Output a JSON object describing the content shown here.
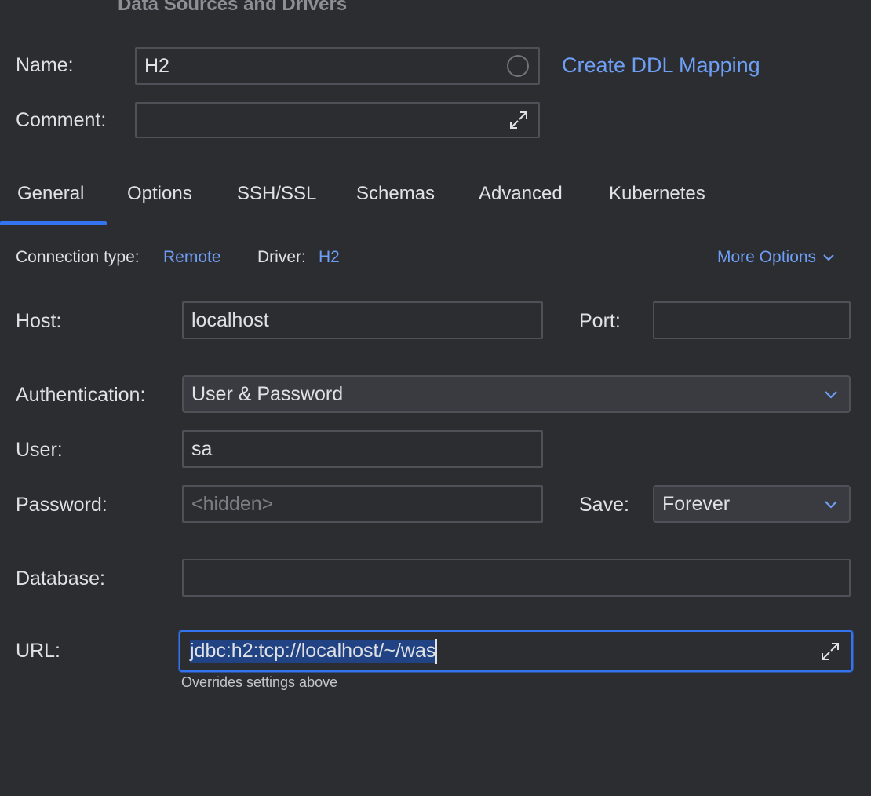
{
  "dialog": {
    "title": "Data Sources and Drivers"
  },
  "name_field": {
    "label": "Name:",
    "value": "H2"
  },
  "ddl_link": "Create DDL Mapping",
  "comment_field": {
    "label": "Comment:",
    "value": ""
  },
  "tabs": [
    {
      "label": "General",
      "active": true
    },
    {
      "label": "Options"
    },
    {
      "label": "SSH/SSL"
    },
    {
      "label": "Schemas"
    },
    {
      "label": "Advanced"
    },
    {
      "label": "Kubernetes"
    }
  ],
  "connection": {
    "type_label": "Connection type:",
    "type_value": "Remote",
    "driver_label": "Driver:",
    "driver_value": "H2",
    "more_options": "More Options"
  },
  "host": {
    "label": "Host:",
    "value": "localhost"
  },
  "port": {
    "label": "Port:",
    "value": ""
  },
  "authentication": {
    "label": "Authentication:",
    "value": "User & Password"
  },
  "user": {
    "label": "User:",
    "value": "sa"
  },
  "password": {
    "label": "Password:",
    "placeholder": "<hidden>"
  },
  "save": {
    "label": "Save:",
    "value": "Forever"
  },
  "database": {
    "label": "Database:",
    "value": ""
  },
  "url": {
    "label": "URL:",
    "value": "jdbc:h2:tcp://localhost/~/was",
    "hint": "Overrides settings above"
  },
  "colors": {
    "background": "#2b2d30",
    "accent": "#3574f0",
    "link": "#6f9ef5",
    "selection": "#214283"
  }
}
